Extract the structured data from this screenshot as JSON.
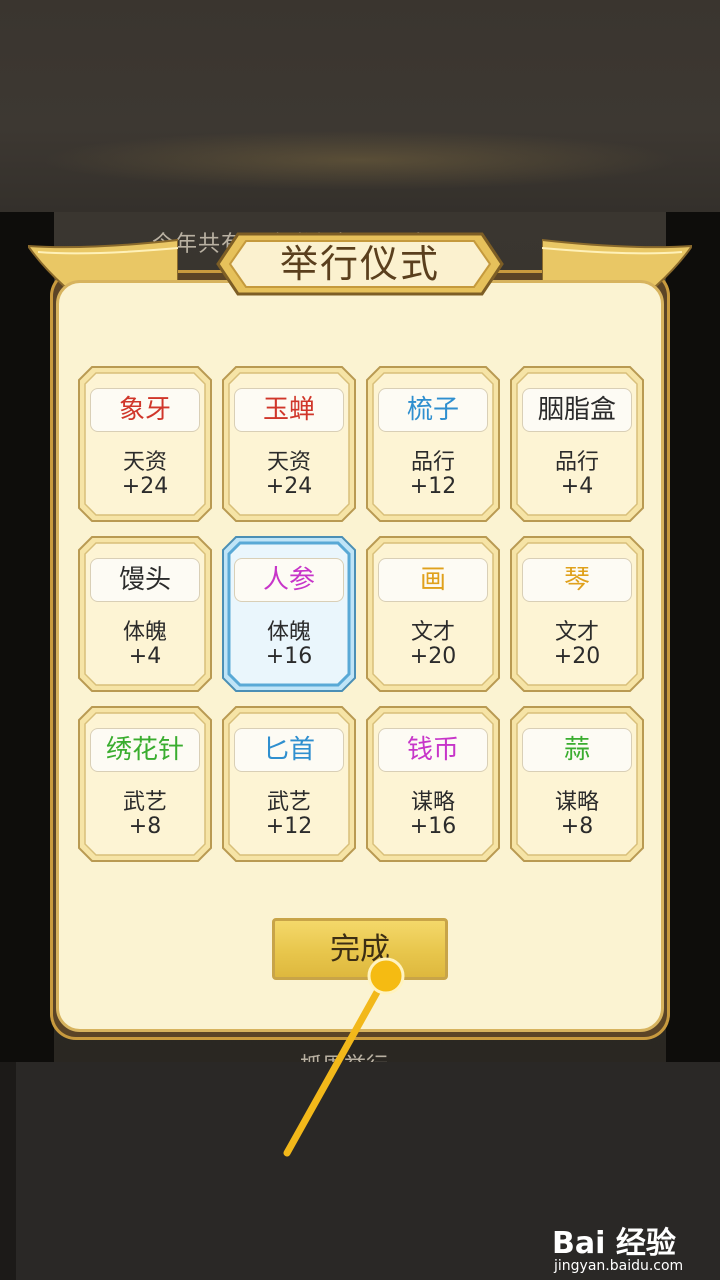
{
  "background": {
    "top_text": "今年共有一次举行抓周仪式",
    "bottom_text": "抓周举行"
  },
  "dialog": {
    "title": "举行仪式",
    "items": [
      {
        "name": "象牙",
        "name_color": "#d0362a",
        "attribute": "天资",
        "bonus": "+24",
        "selected": false
      },
      {
        "name": "玉蝉",
        "name_color": "#d0362a",
        "attribute": "天资",
        "bonus": "+24",
        "selected": false
      },
      {
        "name": "梳子",
        "name_color": "#2f8fcf",
        "attribute": "品行",
        "bonus": "+12",
        "selected": false
      },
      {
        "name": "胭脂盒",
        "name_color": "#2b2b2b",
        "attribute": "品行",
        "bonus": "+4",
        "selected": false
      },
      {
        "name": "馒头",
        "name_color": "#2b2b2b",
        "attribute": "体魄",
        "bonus": "+4",
        "selected": false
      },
      {
        "name": "人参",
        "name_color": "#c735c9",
        "attribute": "体魄",
        "bonus": "+16",
        "selected": true
      },
      {
        "name": "画",
        "name_color": "#e0a11c",
        "attribute": "文才",
        "bonus": "+20",
        "selected": false
      },
      {
        "name": "琴",
        "name_color": "#e0a11c",
        "attribute": "文才",
        "bonus": "+20",
        "selected": false
      },
      {
        "name": "绣花针",
        "name_color": "#3aad2f",
        "attribute": "武艺",
        "bonus": "+8",
        "selected": false
      },
      {
        "name": "匕首",
        "name_color": "#2f8fcf",
        "attribute": "武艺",
        "bonus": "+12",
        "selected": false
      },
      {
        "name": "钱币",
        "name_color": "#c735c9",
        "attribute": "谋略",
        "bonus": "+16",
        "selected": false
      },
      {
        "name": "蒜",
        "name_color": "#3aad2f",
        "attribute": "谋略",
        "bonus": "+8",
        "selected": false
      }
    ],
    "done_label": "完成"
  },
  "watermark": {
    "logo": "Bai  经验",
    "url": "jingyan.baidu.com"
  },
  "colors": {
    "accent_gold": "#e8c64c",
    "panel_cream": "#fbf3d2",
    "frame_brown": "#5b4426",
    "selected_blue": "#7fc6ec"
  }
}
